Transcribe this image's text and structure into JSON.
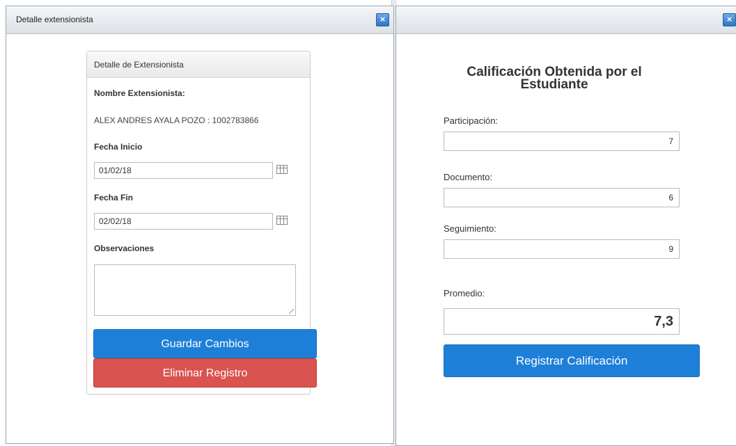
{
  "left_dialog": {
    "title": "Detalle extensionista",
    "close_label": "×",
    "panel": {
      "heading": "Detalle de Extensionista",
      "name_label": "Nombre Extensionista:",
      "name_value": "ALEX ANDRES AYALA POZO : 1002783866",
      "start_label": "Fecha Inicio",
      "start_value": "01/02/18",
      "end_label": "Fecha Fin",
      "end_value": "02/02/18",
      "obs_label": "Observaciones",
      "obs_value": "",
      "save_label": "Guardar Cambios",
      "delete_label": "Eliminar Registro"
    }
  },
  "right_dialog": {
    "title": "",
    "close_label": "×",
    "heading": "Calificación Obtenida por el Estudiante",
    "participacion_label": "Participación:",
    "participacion_value": "7",
    "documento_label": "Documento:",
    "documento_value": "6",
    "seguimiento_label": "Seguimiento:",
    "seguimiento_value": "9",
    "promedio_label": "Promedio:",
    "promedio_value": "7,3",
    "register_label": "Registrar Calificación"
  },
  "colors": {
    "primary": "#1e7fd9",
    "danger": "#d9534f",
    "titlebar": "#dde2e7"
  }
}
